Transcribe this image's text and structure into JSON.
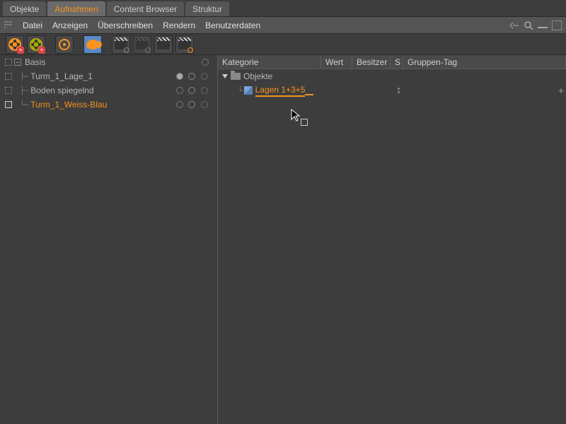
{
  "tabs": {
    "objekte": "Objekte",
    "aufnahmen": "Aufnahmen",
    "content_browser": "Content Browser",
    "struktur": "Struktur"
  },
  "menu": {
    "datei": "Datei",
    "anzeigen": "Anzeigen",
    "ueberschreiben": "Überschreiben",
    "rendern": "Rendern",
    "benutzerdaten": "Benutzerdaten"
  },
  "left_tree": {
    "basis": "Basis",
    "items": [
      {
        "label": "Turm_1_Lage_1"
      },
      {
        "label": "Boden spiegelnd"
      },
      {
        "label": "Turm_1_Weiss-Blau"
      }
    ]
  },
  "right_panel": {
    "headers": {
      "kategorie": "Kategorie",
      "wert": "Wert",
      "besitzer": "Besitzer",
      "s": "S",
      "gruppen_tag": "Gruppen-Tag"
    },
    "objekte_label": "Objekte",
    "lagen_label": "Lagen 1+3+5"
  }
}
